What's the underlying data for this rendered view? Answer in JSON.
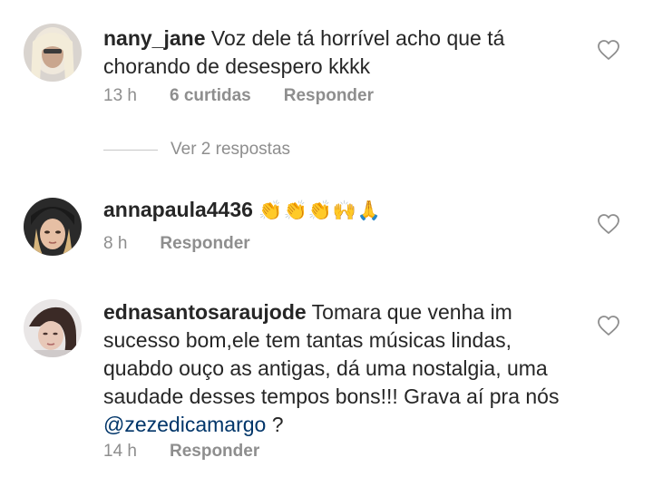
{
  "comments": [
    {
      "username": "nany_jane",
      "text": "Voz dele tá horrível acho que tá chorando de desespero kkkk",
      "time": "13 h",
      "likes": "6 curtidas",
      "reply_label": "Responder",
      "avatar_icon": "avatar-photo",
      "like_icon": "heart-outline-icon"
    },
    {
      "username": "annapaula4436",
      "text": "👏👏👏🙌🙏",
      "time": "8 h",
      "reply_label": "Responder",
      "avatar_icon": "avatar-photo",
      "like_icon": "heart-outline-icon"
    },
    {
      "username": "ednasantosaraujode",
      "text_before": "Tomara que venha im sucesso bom,ele tem tantas músicas lindas, quabdo ouço as antigas, dá uma nostalgia, uma saudade desses tempos bons!!! Grava aí pra nós ",
      "mention": "@zezedicamargo",
      "text_after": " ?",
      "time": "14 h",
      "reply_label": "Responder",
      "avatar_icon": "avatar-photo",
      "like_icon": "heart-outline-icon"
    }
  ],
  "view_replies": "Ver 2 respostas",
  "colors": {
    "text": "#262626",
    "muted": "#8e8e8e",
    "mention": "#003569"
  }
}
